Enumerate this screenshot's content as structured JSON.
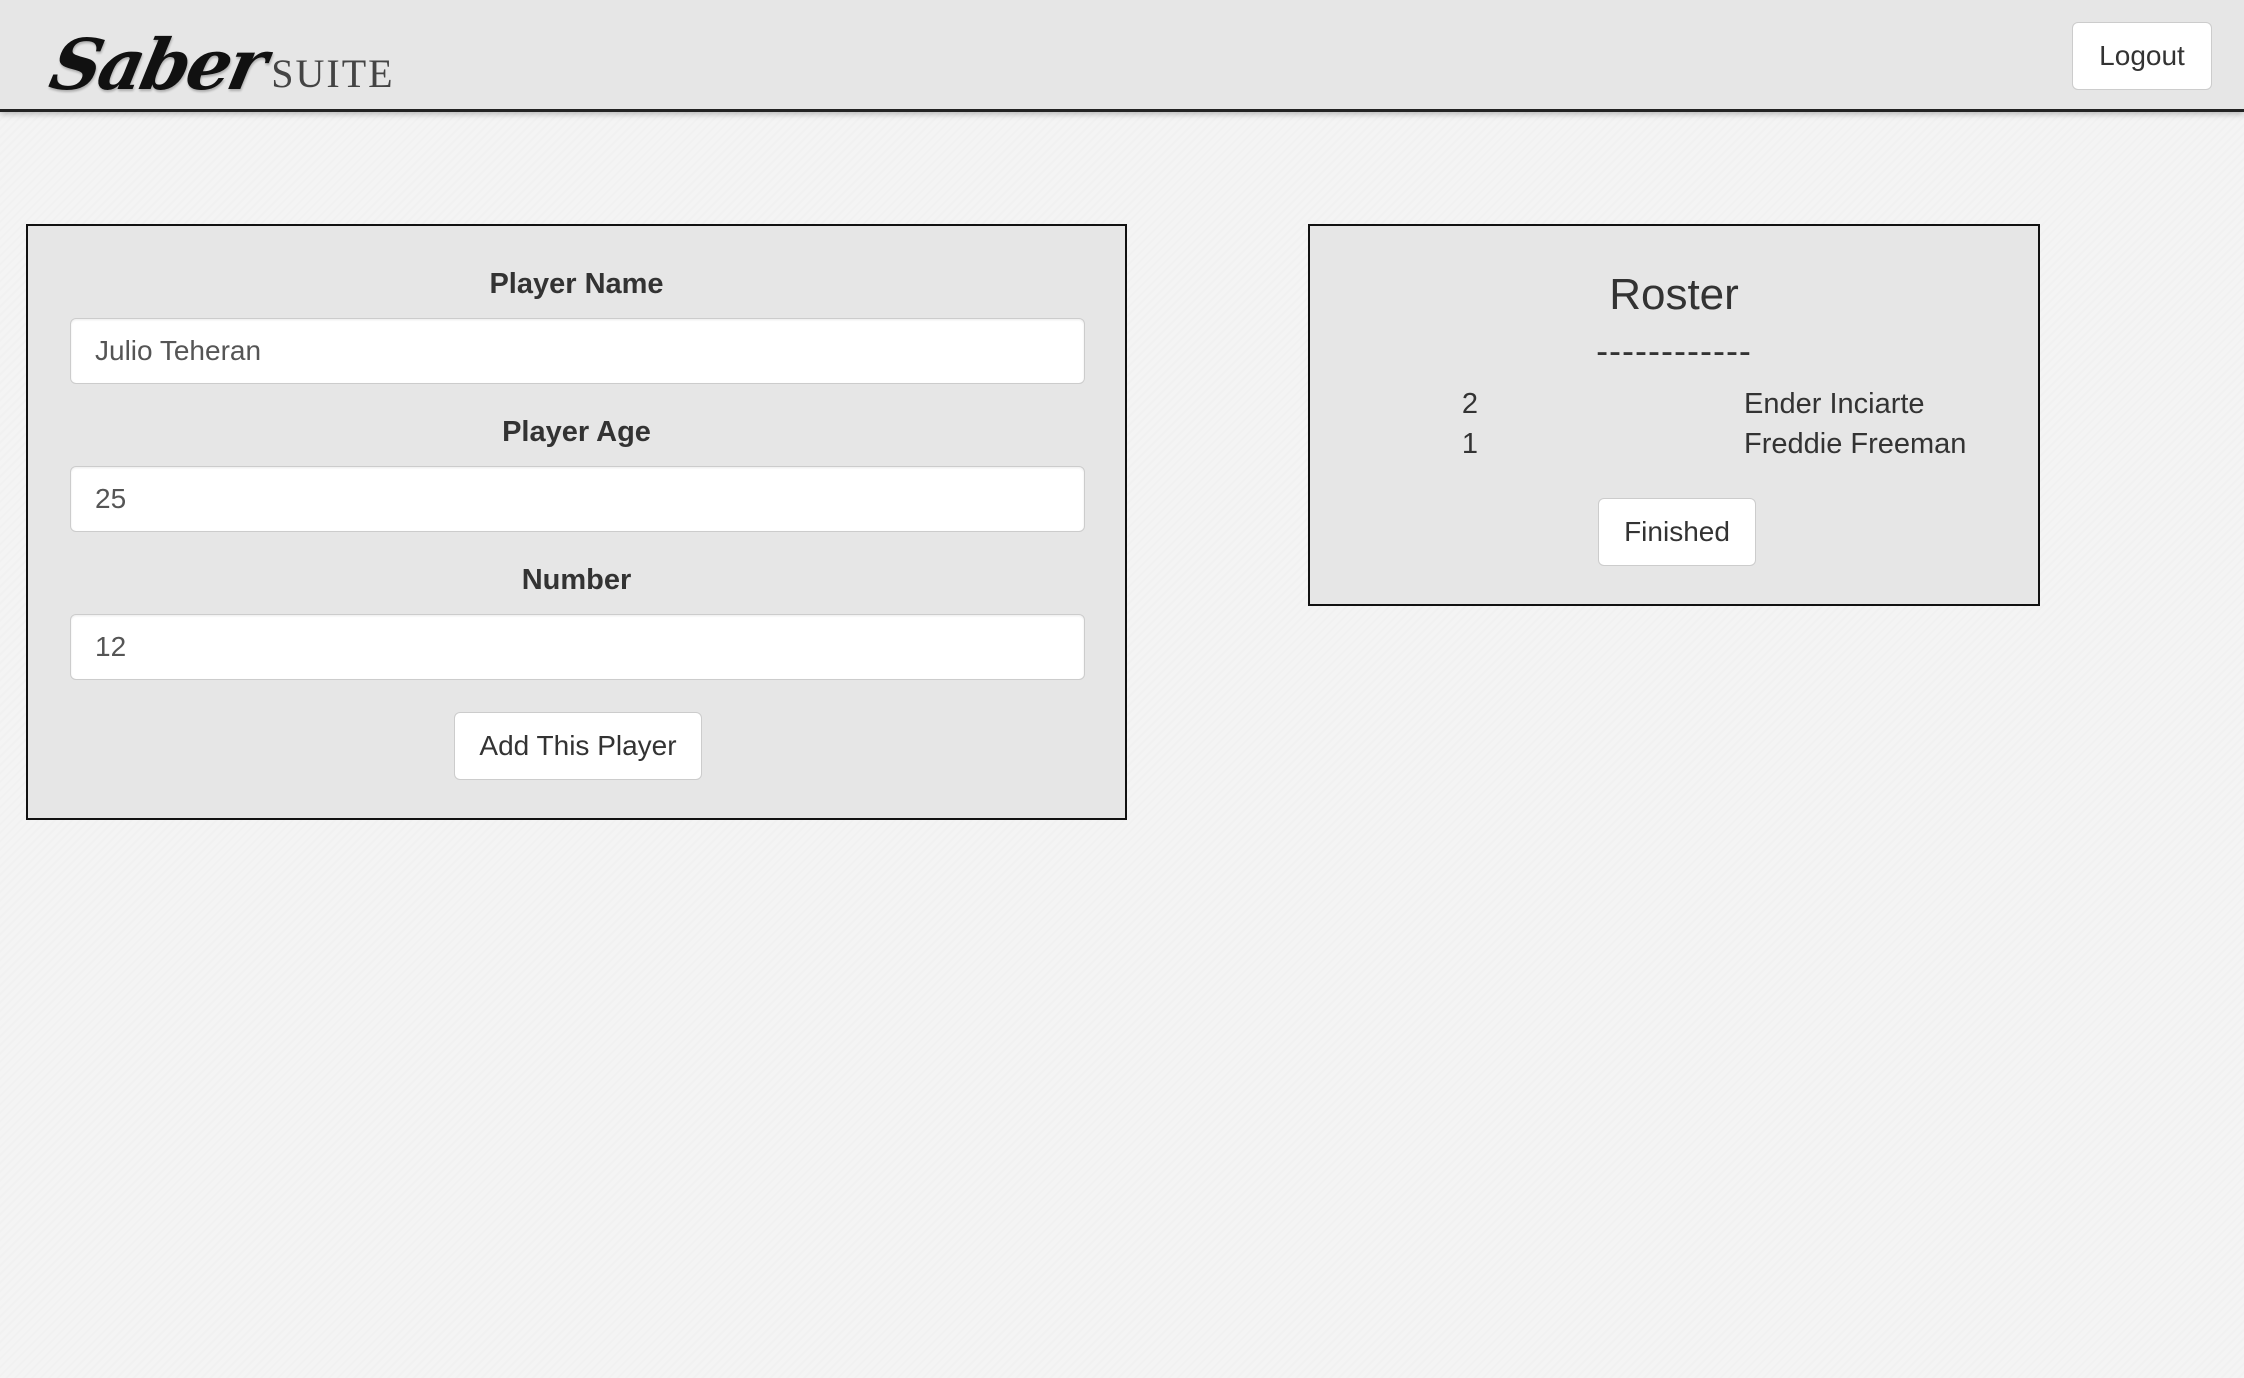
{
  "header": {
    "brand_script": "Saber",
    "brand_suite": "SUITE",
    "logout_label": "Logout"
  },
  "form": {
    "name_label": "Player Name",
    "name_value": "Julio Teheran",
    "age_label": "Player Age",
    "age_value": "25",
    "number_label": "Number",
    "number_value": "12",
    "submit_label": "Add This Player"
  },
  "roster": {
    "title": "Roster",
    "divider": "------------",
    "rows": [
      {
        "number": "2",
        "name": "Ender Inciarte"
      },
      {
        "number": "1",
        "name": "Freddie Freeman"
      }
    ],
    "finished_label": "Finished"
  }
}
